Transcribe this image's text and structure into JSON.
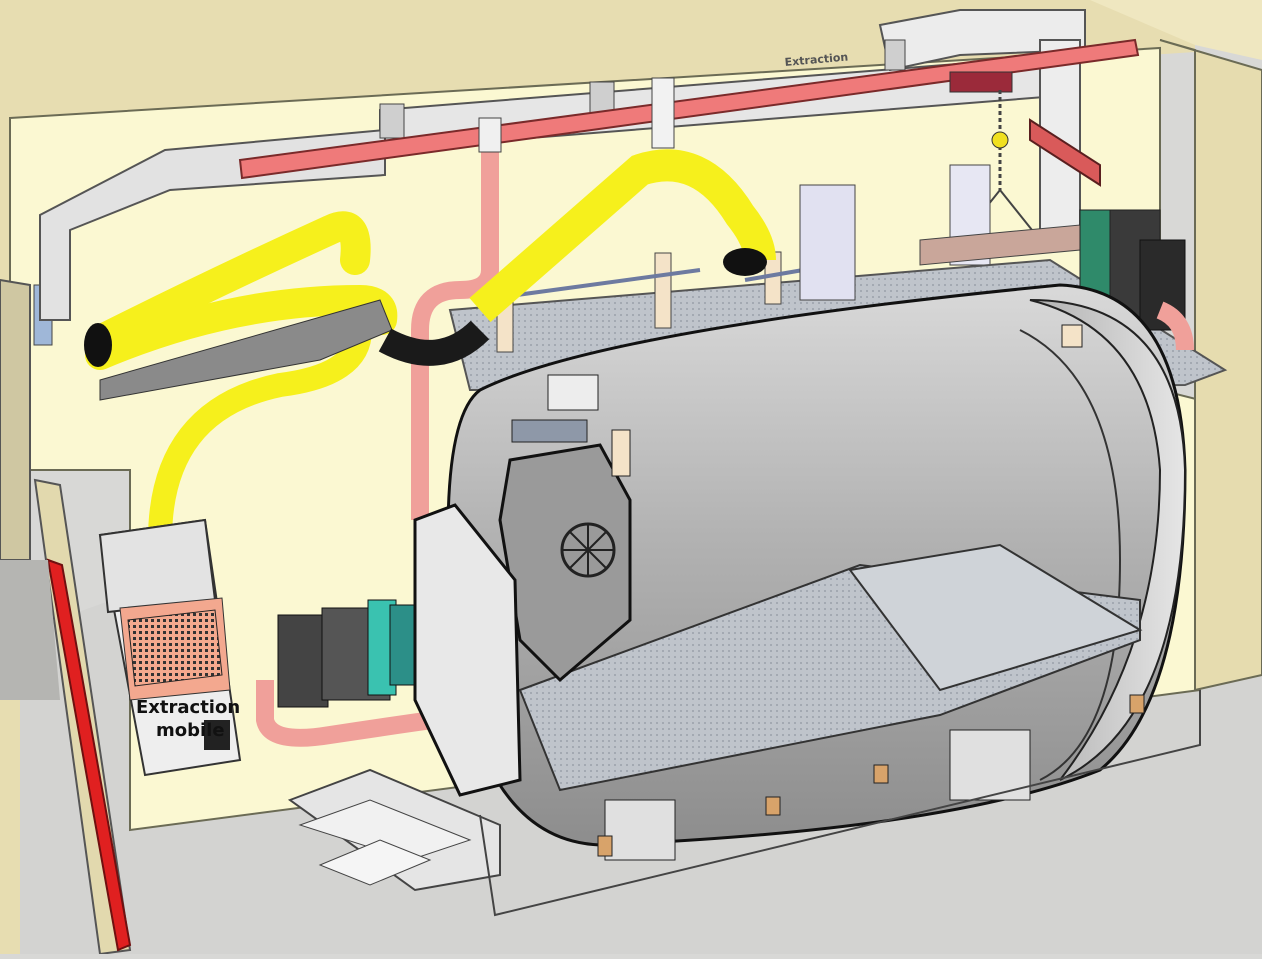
{
  "labels": {
    "duct_label": "Extraction",
    "unit_label_line1": "Extraction",
    "unit_label_line2": "mobile"
  },
  "colors": {
    "wall": "#fbf8d2",
    "wall_outline": "#e6dcaf",
    "floor": "#cfcfcf",
    "duct": "#e4e4e4",
    "beam": "#ef7a7a",
    "hose_yellow": "#f6f01c",
    "pipe_pink": "#f0a09a",
    "vessel": "#b9b9b9",
    "grate": "#b9c0c9",
    "red_door": "#e02020"
  }
}
